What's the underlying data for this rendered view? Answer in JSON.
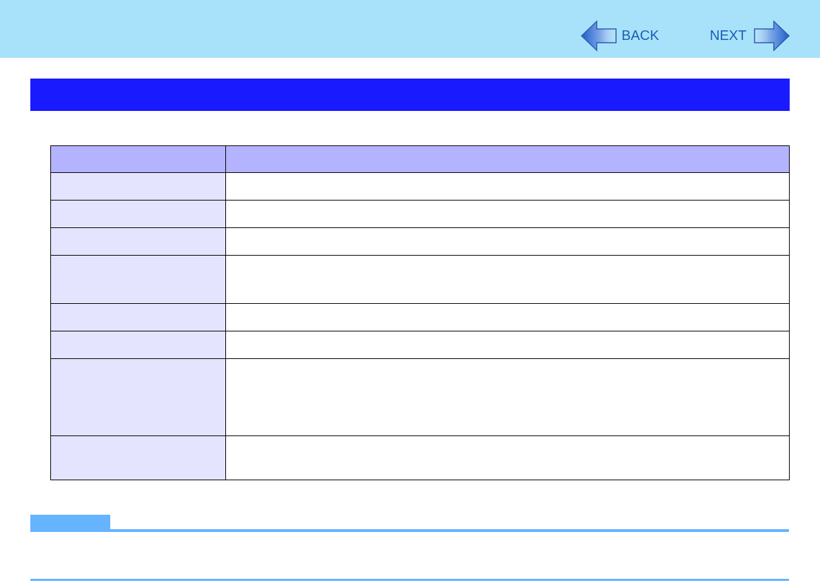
{
  "nav": {
    "back_label": "BACK",
    "next_label": "NEXT"
  },
  "colors": {
    "header_bar": "#a8e2fa",
    "title_band": "#1a1aff",
    "table_header": "#b3b3ff",
    "label_cell": "#e4e4ff",
    "note_accent": "#66b3ff",
    "arrow_blue": "#2d6fd0"
  },
  "title": "",
  "table": {
    "headers": [
      "",
      ""
    ],
    "rows": [
      {
        "label": "",
        "value": ""
      },
      {
        "label": "",
        "value": ""
      },
      {
        "label": "",
        "value": ""
      },
      {
        "label": "",
        "value": ""
      },
      {
        "label": "",
        "value": ""
      },
      {
        "label": "",
        "value": ""
      },
      {
        "label": "",
        "value": ""
      },
      {
        "label": "",
        "value": ""
      }
    ]
  },
  "note": {
    "tab_label": "",
    "text": ""
  }
}
